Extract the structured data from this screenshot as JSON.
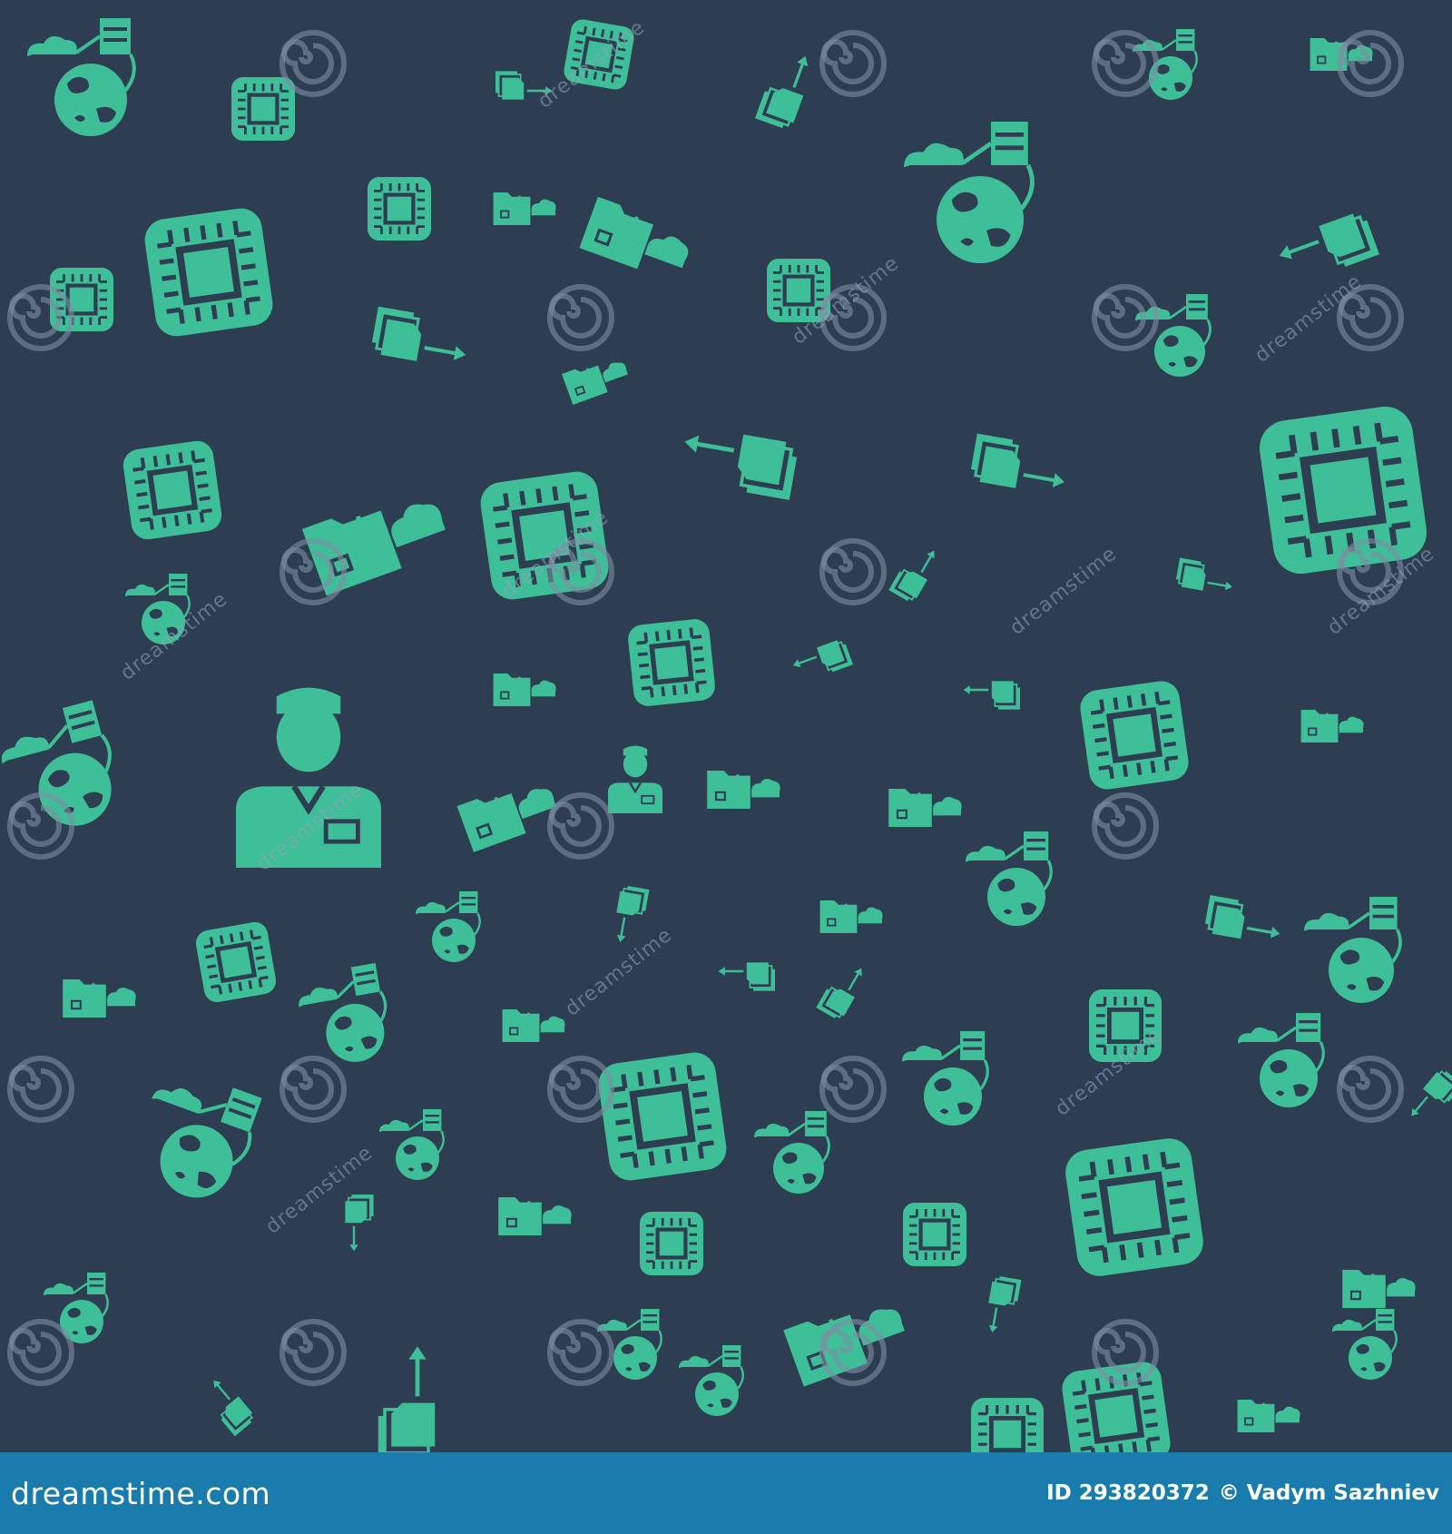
{
  "watermark": {
    "text": "dreamstime"
  },
  "footer": {
    "brand": "dreamstime.com",
    "image_id": "ID 293820372",
    "copyright_author": "© Vadym Sazhniev"
  },
  "colors": {
    "background": "#2e3e52",
    "icon": "#3fbf97",
    "footer": "#1a7cad",
    "watermark": "#8fa4bd"
  },
  "icons": [
    "chip-icon",
    "globe-network-icon",
    "folder-cloud-icon",
    "documents-arrow-icon",
    "technician-icon"
  ]
}
